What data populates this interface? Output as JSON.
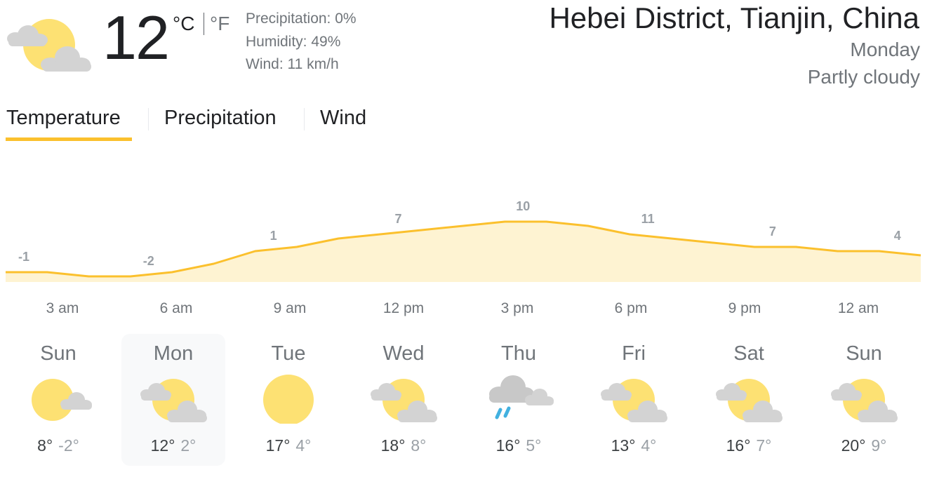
{
  "current": {
    "temperature": "12",
    "unit_c": "°C",
    "unit_f": "°F",
    "precipitation": "Precipitation: 0%",
    "humidity": "Humidity: 49%",
    "wind": "Wind: 11 km/h",
    "icon": "partly-cloudy-icon"
  },
  "location": "Hebei District, Tianjin, China",
  "day_name": "Monday",
  "condition": "Partly cloudy",
  "tabs": [
    {
      "label": "Temperature",
      "selected": true
    },
    {
      "label": "Precipitation",
      "selected": false
    },
    {
      "label": "Wind",
      "selected": false
    }
  ],
  "colors": {
    "accent": "#fbc02d",
    "area_fill": "#fef3d2",
    "sun": "#fde173",
    "cloud": "#d3d3d3",
    "rain": "#42b1e0"
  },
  "chart_data": {
    "type": "area",
    "x": [
      "3 am",
      "6 am",
      "9 am",
      "12 pm",
      "3 pm",
      "6 pm",
      "9 pm",
      "12 am"
    ],
    "values": [
      -1,
      -2,
      1,
      7,
      10,
      11,
      7,
      4
    ],
    "point_values": [
      -1,
      -1,
      -2,
      -2,
      -1,
      1,
      4,
      5,
      7,
      8,
      9,
      10,
      11,
      11,
      10,
      8,
      7,
      6,
      5,
      5,
      4,
      4,
      3
    ],
    "ylim": [
      -3,
      12
    ]
  },
  "days": [
    {
      "name": "Sun",
      "high": "8°",
      "low": "-2°",
      "icon": "partly-cloudy-icon",
      "selected": false
    },
    {
      "name": "Mon",
      "high": "12°",
      "low": "2°",
      "icon": "partly-cloudy-icon",
      "selected": true
    },
    {
      "name": "Tue",
      "high": "17°",
      "low": "4°",
      "icon": "sunny-icon",
      "selected": false
    },
    {
      "name": "Wed",
      "high": "18°",
      "low": "8°",
      "icon": "partly-cloudy-icon",
      "selected": false
    },
    {
      "name": "Thu",
      "high": "16°",
      "low": "5°",
      "icon": "rain-showers-icon",
      "selected": false
    },
    {
      "name": "Fri",
      "high": "13°",
      "low": "4°",
      "icon": "partly-cloudy-icon",
      "selected": false
    },
    {
      "name": "Sat",
      "high": "16°",
      "low": "7°",
      "icon": "partly-cloudy-icon",
      "selected": false
    },
    {
      "name": "Sun",
      "high": "20°",
      "low": "9°",
      "icon": "partly-cloudy-icon",
      "selected": false
    }
  ]
}
